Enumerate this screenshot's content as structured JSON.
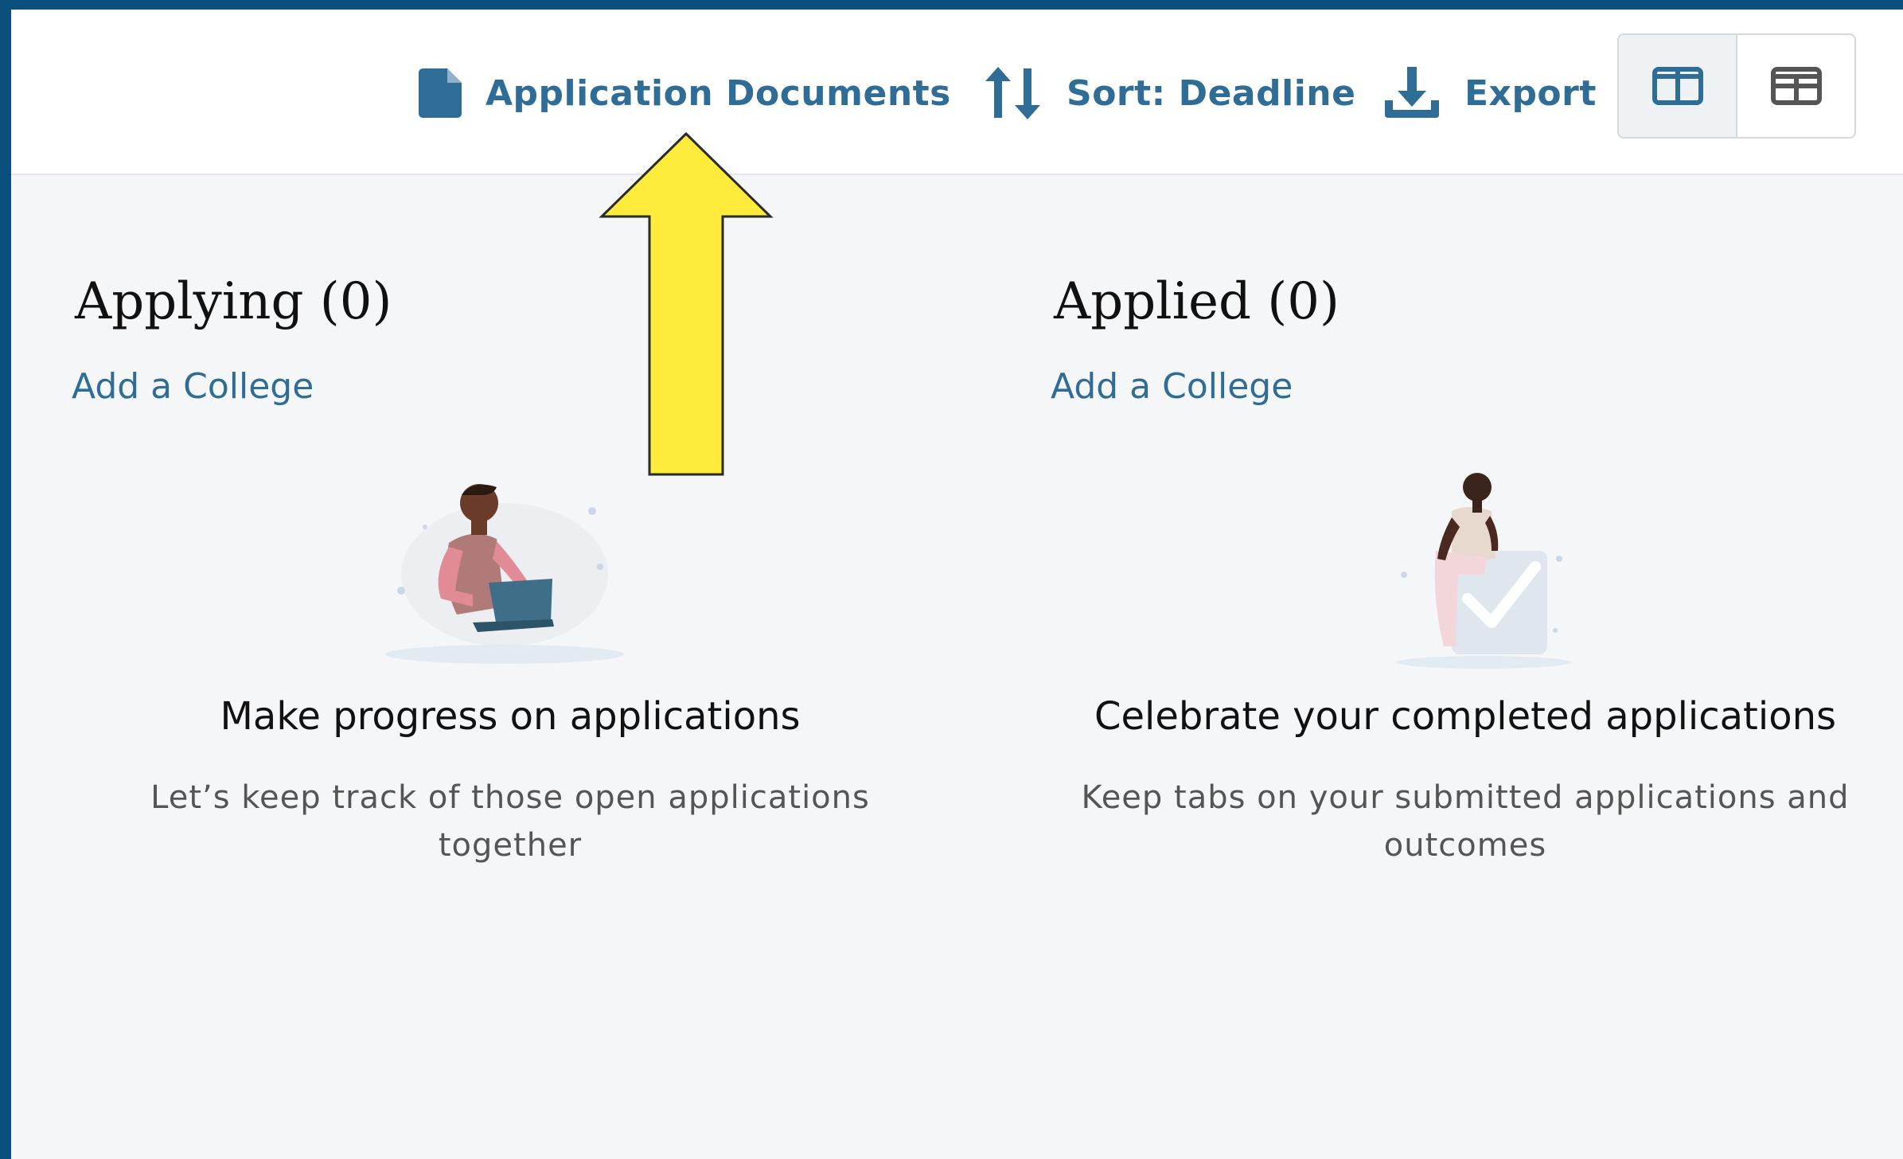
{
  "toolbar": {
    "documents_label": "Application Documents",
    "sort_label": "Sort: Deadline",
    "export_label": "Export",
    "icons": {
      "documents": "document-icon",
      "sort": "sort-arrows-icon",
      "export": "download-icon",
      "board_view": "board-view-icon",
      "table_view": "table-view-icon"
    }
  },
  "columns": [
    {
      "title": "Applying (0)",
      "link": "Add a College",
      "empty_title": "Make progress on applications",
      "empty_desc": "Let’s keep track of those open applications together"
    },
    {
      "title": "Applied (0)",
      "link": "Add a College",
      "empty_title": "Celebrate your completed applications",
      "empty_desc": "Keep tabs on your submitted applications and outcomes"
    }
  ],
  "colors": {
    "accent": "#2f6d97",
    "frame": "#0b4f7c",
    "annotation_arrow": "#ffeb3b"
  }
}
